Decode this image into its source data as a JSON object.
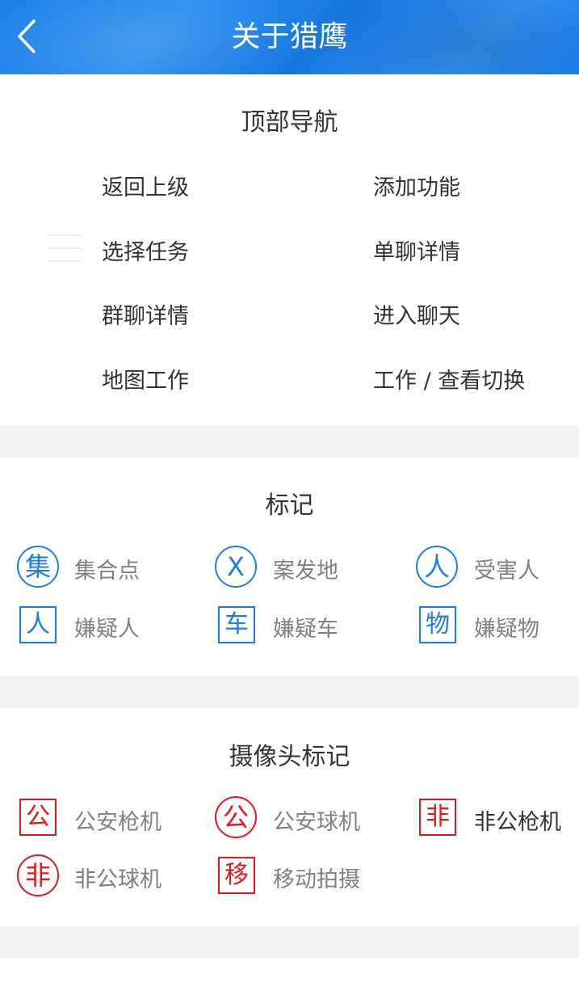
{
  "header": {
    "title": "关于猎鹰",
    "back_icon": "chevron-left-icon"
  },
  "top_nav_section": {
    "title": "顶部导航",
    "items": [
      "返回上级",
      "添加功能",
      "选择任务",
      "单聊详情",
      "群聊详情",
      "进入聊天",
      "地图工作",
      "工作 / 查看切换"
    ]
  },
  "marks_section": {
    "title": "标记",
    "items": [
      {
        "glyph": "集",
        "label": "集合点",
        "shape": "circle",
        "color": "#1a7de8"
      },
      {
        "glyph": "X",
        "label": "案发地",
        "shape": "circle",
        "color": "#1a7de8"
      },
      {
        "glyph": "人",
        "label": "受害人",
        "shape": "circle",
        "color": "#1a7de8"
      },
      {
        "glyph": "人",
        "label": "嫌疑人",
        "shape": "square",
        "color": "#1a7de8"
      },
      {
        "glyph": "车",
        "label": "嫌疑车",
        "shape": "square",
        "color": "#1a7de8"
      },
      {
        "glyph": "物",
        "label": "嫌疑物",
        "shape": "square",
        "color": "#1a7de8"
      }
    ]
  },
  "camera_section": {
    "title": "摄像头标记",
    "items": [
      {
        "glyph": "公",
        "label": "公安枪机",
        "shape": "square",
        "color": "#e8151b"
      },
      {
        "glyph": "公",
        "label": "公安球机",
        "shape": "circle",
        "color": "#e8151b"
      },
      {
        "glyph": "非",
        "label": "非公枪机",
        "shape": "square",
        "color": "#e8151b"
      },
      {
        "glyph": "非",
        "label": "非公球机",
        "shape": "circle",
        "color": "#e8151b"
      },
      {
        "glyph": "移",
        "label": "移动拍摄",
        "shape": "square",
        "color": "#e8151b"
      }
    ]
  },
  "colors": {
    "header_blue": "#1a7de8",
    "mark_blue": "#1a7de8",
    "mark_red": "#e8151b",
    "divider_gray": "#f2f2f2"
  }
}
